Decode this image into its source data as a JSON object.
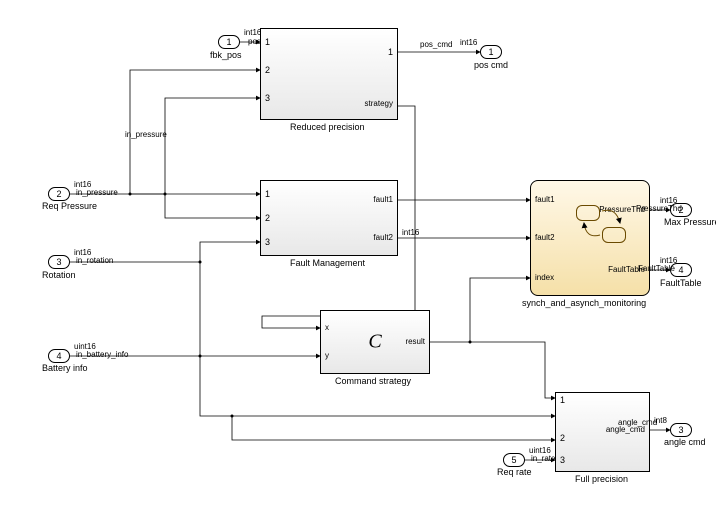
{
  "inports": {
    "p1": {
      "num": "1",
      "name": "fbk_pos",
      "signal": "pos_info",
      "dtype": "int16"
    },
    "p2": {
      "num": "2",
      "name": "Req Pressure",
      "signal": "in_pressure",
      "dtype": "int16"
    },
    "p3": {
      "num": "3",
      "name": "Rotation",
      "signal": "in_rotation",
      "dtype": "int16"
    },
    "p4": {
      "num": "4",
      "name": "Battery info",
      "signal": "in_battery_info",
      "dtype": "uint16"
    },
    "p5": {
      "num": "5",
      "name": "Req rate",
      "signal": "in_rate",
      "dtype": "uint16"
    }
  },
  "outports": {
    "o1": {
      "num": "1",
      "name": "pos cmd",
      "signal": "pos_cmd",
      "dtype": "int16"
    },
    "o2": {
      "num": "2",
      "name": "Max Pressure",
      "signal": "PressureThd",
      "dtype": "int16"
    },
    "o3": {
      "num": "3",
      "name": "angle cmd",
      "signal": "angle_cmd",
      "dtype": "int8"
    },
    "o4": {
      "num": "4",
      "name": "FaultTable",
      "signal": "FaultTable",
      "dtype": "int16"
    }
  },
  "blocks": {
    "reduced": {
      "name": "Reduced precision",
      "in": {
        "i1": "1",
        "i2": "2",
        "i3": "3"
      },
      "out": {
        "o1": "1",
        "o2": "strategy"
      }
    },
    "fault": {
      "name": "Fault Management",
      "in": {
        "i1": "1",
        "i2": "2",
        "i3": "3"
      },
      "out": {
        "o1": "fault1",
        "o2": "fault2"
      },
      "o2_dtype": "int16"
    },
    "cmd": {
      "name": "Command strategy",
      "center": "C",
      "in": {
        "x": "x",
        "y": "y"
      },
      "out": {
        "r": "result"
      }
    },
    "full": {
      "name": "Full precision",
      "in": {
        "i1": "1",
        "i2": "2",
        "i3": "3"
      },
      "out": {
        "o1": "angle_cmd"
      }
    },
    "monitor": {
      "name": "synch_and_asynch_monitoring",
      "in": {
        "f1": "fault1",
        "f2": "fault2",
        "idx": "index"
      },
      "out": {
        "pt": "PressureThd",
        "ft": "FaultTable"
      }
    }
  }
}
